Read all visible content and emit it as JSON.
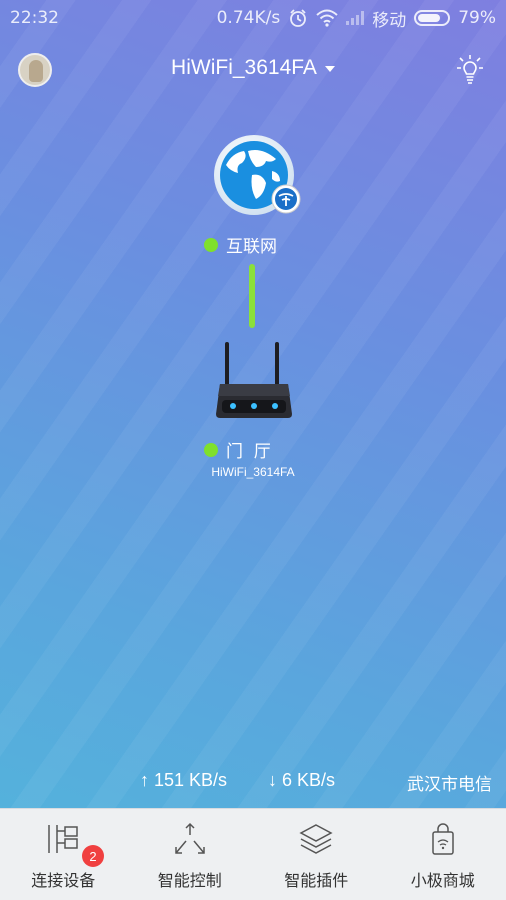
{
  "status_bar": {
    "time": "22:32",
    "speed": "0.74K/s",
    "carrier": "移动",
    "battery": "79%",
    "battery_level": 0.79
  },
  "header": {
    "network_name": "HiWiFi_3614FA",
    "avatar_icon": "user-avatar",
    "bulb_icon": "lightbulb-icon"
  },
  "topology": {
    "internet": {
      "label": "互联网",
      "status_color": "#7fe02c",
      "icon": "globe-telecom-icon"
    },
    "router": {
      "label": "门  厅",
      "subname": "HiWiFi_3614FA",
      "status_color": "#7fe02c",
      "icon": "router-icon"
    }
  },
  "speeds": {
    "upload": "↑ 151 KB/s",
    "download": "↓ 6 KB/s",
    "isp": "武汉市电信"
  },
  "bottom_nav": {
    "items": [
      {
        "label": "连接设备",
        "icon": "devices-tree-icon",
        "badge": "2"
      },
      {
        "label": "智能控制",
        "icon": "expand-arrows-icon"
      },
      {
        "label": "智能插件",
        "icon": "layers-icon"
      },
      {
        "label": "小极商城",
        "icon": "shopping-bag-icon"
      }
    ]
  }
}
